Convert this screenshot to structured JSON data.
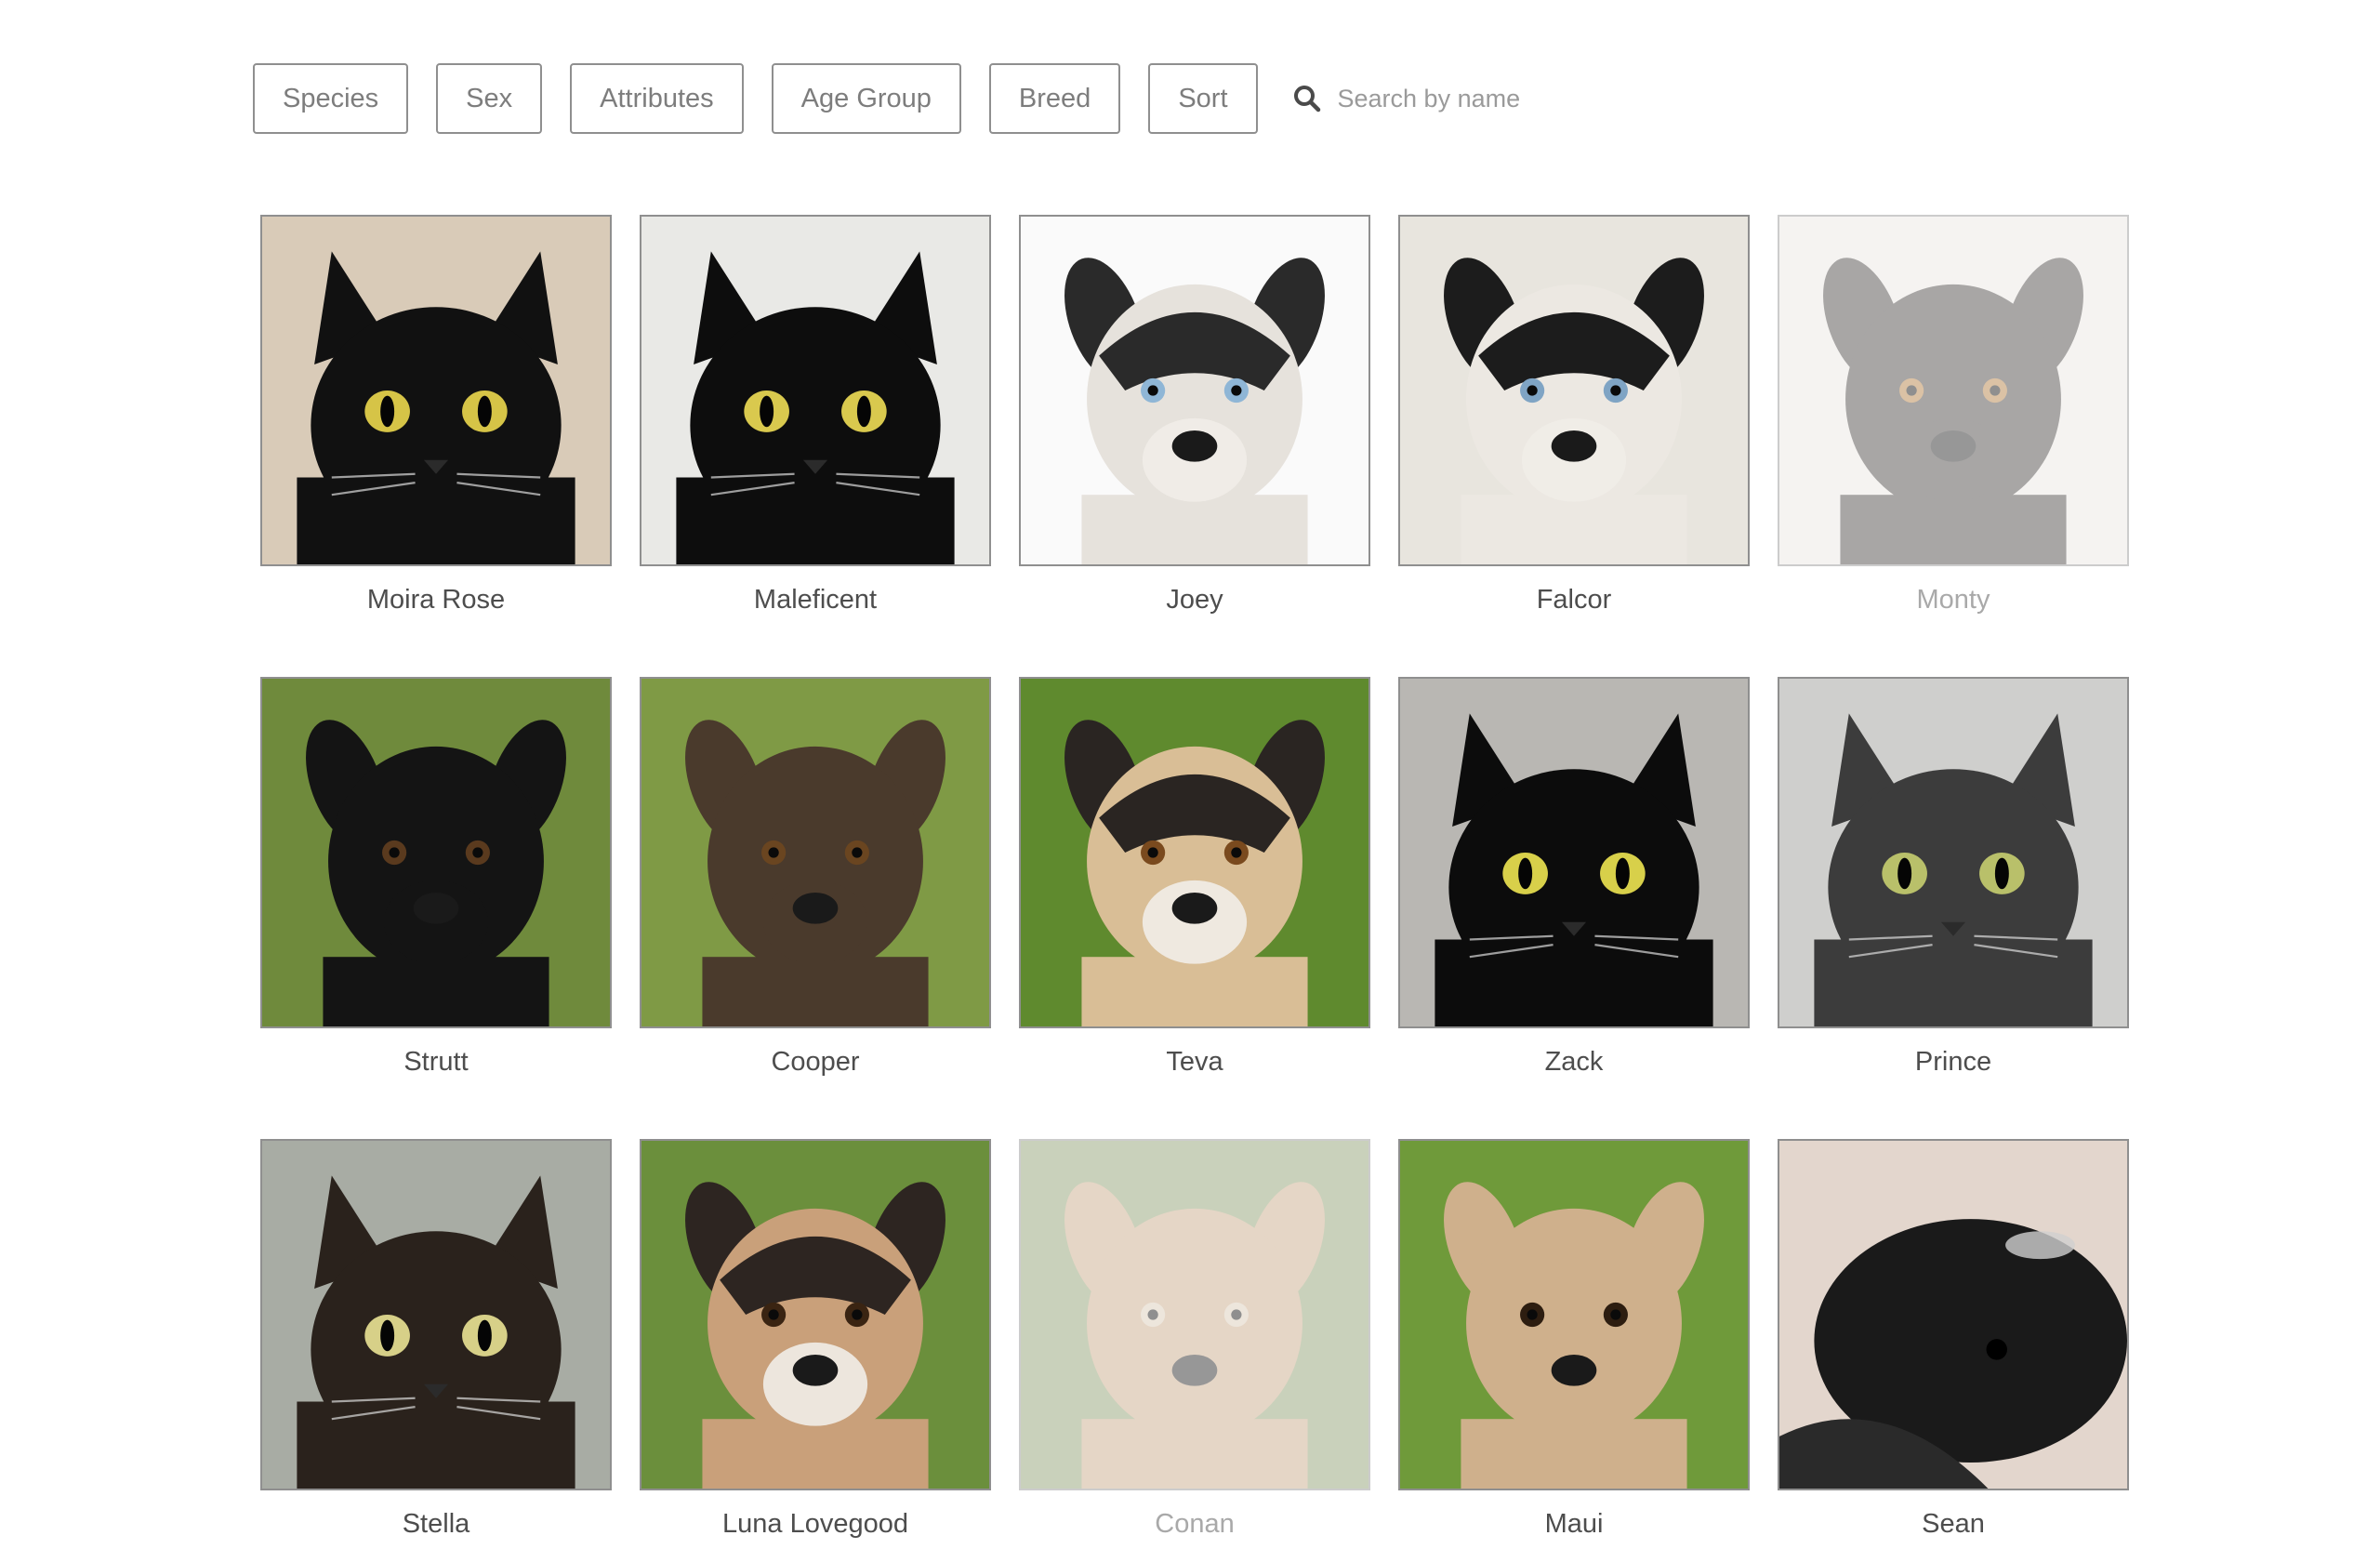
{
  "filters": {
    "species": "Species",
    "sex": "Sex",
    "attributes": "Attributes",
    "age_group": "Age Group",
    "breed": "Breed",
    "sort": "Sort"
  },
  "search": {
    "placeholder": "Search by name",
    "icon": "search-icon"
  },
  "pets": [
    {
      "name": "Moira Rose",
      "animal": "cat",
      "fur": "#111111",
      "bg": "#d9cbb8",
      "eyes": "#d6c447",
      "faded": false
    },
    {
      "name": "Maleficent",
      "animal": "cat",
      "fur": "#0d0d0d",
      "bg": "#e9e9e6",
      "eyes": "#d9c94e",
      "faded": false
    },
    {
      "name": "Joey",
      "animal": "dog",
      "fur": "#e6e2dc",
      "bg": "#fafafa",
      "mask": "#2a2a2a",
      "eyes": "#8fb6d6",
      "faded": false
    },
    {
      "name": "Falcor",
      "animal": "dog",
      "fur": "#ece8e2",
      "bg": "#e8e5de",
      "mask": "#1c1c1c",
      "eyes": "#7fa4c4",
      "faded": false
    },
    {
      "name": "Monty",
      "animal": "dog",
      "fur": "#3f3b3a",
      "bg": "#ebe6e2",
      "eyes": "#b07a3a",
      "faded": true
    },
    {
      "name": "Strutt",
      "animal": "dog",
      "fur": "#141414",
      "bg": "#6f8a3c",
      "eyes": "#5a3a1e",
      "faded": false
    },
    {
      "name": "Cooper",
      "animal": "dog",
      "fur": "#4a3a2c",
      "bg": "#7f9a45",
      "eyes": "#6a4520",
      "faded": false
    },
    {
      "name": "Teva",
      "animal": "dog",
      "fur": "#d9be96",
      "bg": "#5f8a2e",
      "mask": "#2a2522",
      "eyes": "#7a4a1e",
      "faded": false
    },
    {
      "name": "Zack",
      "animal": "cat",
      "fur": "#0c0c0c",
      "bg": "#b9b7b3",
      "eyes": "#d8d04a",
      "faded": false
    },
    {
      "name": "Prince",
      "animal": "cat",
      "fur": "#3c3c3c",
      "bg": "#cfcfcd",
      "eyes": "#b9c06a",
      "faded": false
    },
    {
      "name": "Stella",
      "animal": "cat",
      "fur": "#2a221c",
      "bg": "#a8aca4",
      "eyes": "#d7d088",
      "faded": false
    },
    {
      "name": "Luna Lovegood",
      "animal": "dog",
      "fur": "#c9a07a",
      "bg": "#6b8f3c",
      "mask": "#2d2521",
      "eyes": "#3a2412",
      "faded": false
    },
    {
      "name": "Conan",
      "animal": "dog",
      "fur": "#c7a582",
      "bg": "#8a9b6a",
      "eyes": "#d9c9b2",
      "faded": true
    },
    {
      "name": "Maui",
      "animal": "dog",
      "fur": "#cfb08c",
      "bg": "#6f9a3a",
      "eyes": "#2d1d10",
      "faded": false
    },
    {
      "name": "Sean",
      "animal": "guinea",
      "fur": "#1a1a1a",
      "bg": "#e3d6cd",
      "eyes": "#0a0a0a",
      "faded": false
    }
  ]
}
